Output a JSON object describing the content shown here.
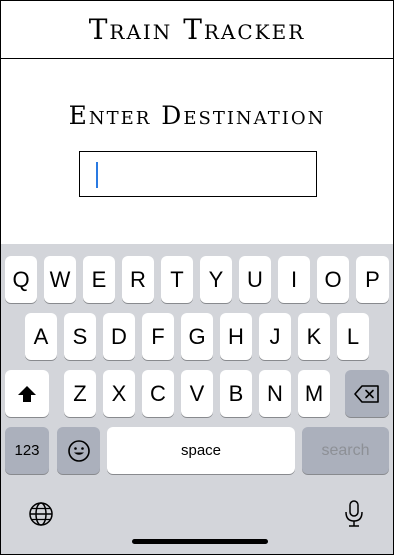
{
  "header": {
    "title": "Train Tracker"
  },
  "destination": {
    "prompt": "Enter Destination",
    "value": ""
  },
  "keyboard": {
    "row1": [
      "Q",
      "W",
      "E",
      "R",
      "T",
      "Y",
      "U",
      "I",
      "O",
      "P"
    ],
    "row2": [
      "A",
      "S",
      "D",
      "F",
      "G",
      "H",
      "J",
      "K",
      "L"
    ],
    "row3": [
      "Z",
      "X",
      "C",
      "V",
      "B",
      "N",
      "M"
    ],
    "numbers_label": "123",
    "space_label": "space",
    "search_label": "search"
  }
}
